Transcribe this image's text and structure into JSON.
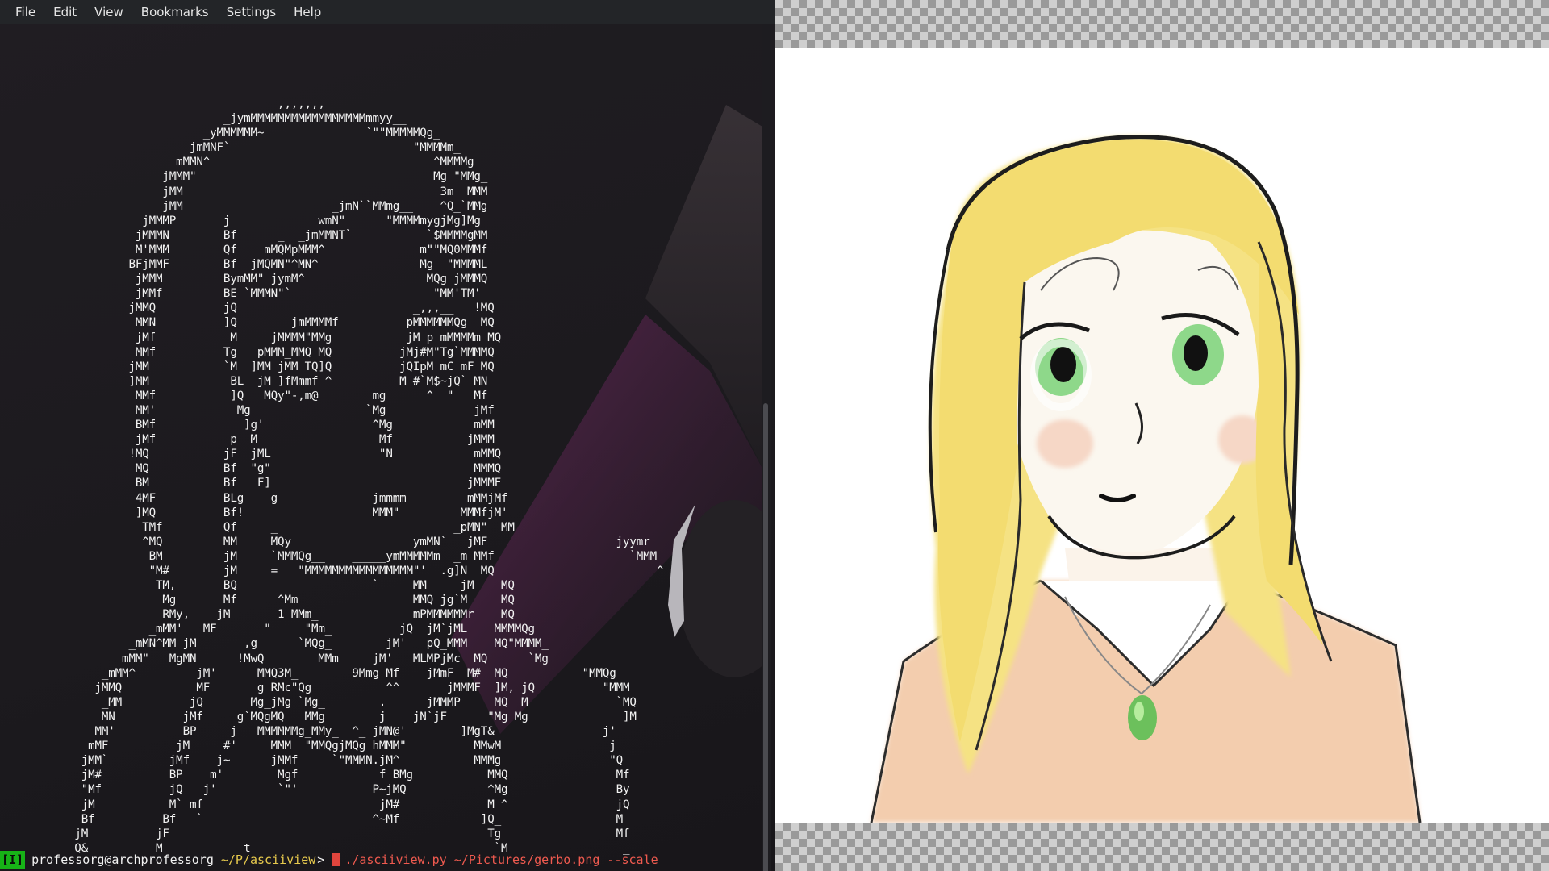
{
  "terminal": {
    "menu": [
      "File",
      "Edit",
      "View",
      "Bookmarks",
      "Settings",
      "Help"
    ],
    "ascii_art": "                                       __,,,,,,,____\n                                 _jymMMMMMMMMMMMMMMMMMmmyy__\n                              _yMMMMMM~               `\"\"MMMMMQg_\n                            jmMNF`                           \"MMMMm_\n                          mMMN^                                 ^MMMMg\n                        jMMM\"                                   Mg \"MMg_\n                        jMM                         ____         3m  MMM\n                        jMM                      _jmN``MMmg__    ^Q_`MMg\n                     jMMMP       j            _wmN\"      \"MMMMmygjMg]Mg\n                    jMMMN        Bf      _  _jmMMNT`           `$MMMMgMM\n                   _M'MMM        Qf   _mMQMpMMM^              m\"\"MQ0MMMf\n                   BFjMMF        Bf  jMQMN\"^MN^               Mg  \"MMMML\n                    jMMM         BymMM\"_jymM^                  MQg jMMMQ\n                    jMMf         BE `MMMN\"`                     \"MM'TM'\n                   jMMQ          jQ                          _,,,__   !MQ\n                    MMN          ]Q        jmMMMMf          pMMMMMMQg  MQ\n                    jMf           M     jMMMM\"MMg           jM p_mMMMMm_MQ\n                    MMf          Tg   pMMM_MMQ MQ          jMj#M\"Tg`MMMMQ\n                   jMM           `M  ]MM jMM TQ]Q          jQIpM_mC mF MQ\n                   ]MM            BL  jM ]fMmmf ^          M #`M$~jQ` MN\n                    MMf           ]Q   MQy\"-,m@        mg      ^  \"   Mf\n                    MM'            Mg                 `Mg             jMf\n                    BMf             ]g'                ^Mg            mMM\n                    jMf           p  M                  Mf           jMMM\n                   !MQ           jF  jML                \"N            mMMQ\n                    MQ           Bf  \"g\"                              MMMQ\n                    BM           Bf   F]                             jMMMF\n                    4MF          BLg    g              jmmmm         mMMjMf\n                    ]MQ          Bf!                   MMM\"        _MMMfjM'\n                     TMf         Qf     _                          _pMN\"  MM\n                     ^MQ         MM     MQy                 _ymMN`   jMF                   jyymr\n                      BM         jM     `MMMQg__    _____ymMMMMMm  _m MMf                    `MMM\n                      \"M#        jM     =   \"MMMMMMMMMMMMMMMM\"'  .g]N  MQ                        ^\n                       TM,       BQ                    `     MM     jM    MQ\n                        Mg       Mf      ^Mm_                MMQ_jg`M     MQ\n                        RMy,    jM       1 MMm_              mPMMMMMMr    MQ\n                      _mMM'   MF       \"     \"Mm_          jQ  jM`jML    MMMMQg\n                   _mMN^MM jM       ,g      `MQg_        jM'   pQ_MMM    MQ\"MMMM_\n                 _mMM\"   MgMN      !MwQ_       MMm_    jM'   MLMPjMc  MQ      `Mg_\n               _mMM^         jM'      MMQ3M_        9Mmg Mf    jMmF  M#  MQ           \"MMQg\n              jMMQ           MF       g RMc\"Qg           ^^       jMMMF  ]M, jQ          \"MMM_\n               _MM          jQ       Mg_jMg `Mg_        .      jMMMP     MQ  M             `MQ\n               MN          jMf     g`MQgMQ_  MMg        j    jN`jF      \"Mg Mg              ]M\n              MM'          BP     j   MMMMMMg_MMy_  ^_ jMN@'        ]MgT&                j'\n             mMF          jM     #'     MMM  \"MMQgjMQg hMMM\"          MMwM                j_\n            jMM`         jMf    j~      jMMf     `\"MMMN.jM^           MMMg                \"Q\n            jM#          BP    m'        Mgf            f BMg           MMQ                Mf\n            \"Mf          jQ   j'         `\"'           P~jMQ            ^Mg                By\n            jM           M` mf                          jM#             M_^                jQ\n            Bf          Bf   `                         ^~Mf            ]Q_                 M\n           jM          jF                                               Tg                 Mf\n           Q&          M            t                                    `M                 _",
    "prompt": {
      "mode": "[I]",
      "user_host": "professorg@archprofessorg",
      "path": "~/P/asciiview",
      "symbol": ">",
      "command": "./asciiview.py ~/Pictures/gerbo.png --scale"
    }
  },
  "viewer": {
    "image_name": "gerbo.png"
  },
  "colors": {
    "prompt_badge": "#17b317",
    "prompt_path": "#e6c94d",
    "prompt_command": "#ef5a4f",
    "cursor": "#e0453d",
    "hair": "#f5e283",
    "eyes": "#8ed88a",
    "skin_top": "#fbf7ef",
    "shirt": "#f3cdae",
    "pendant": "#6cc05c"
  }
}
